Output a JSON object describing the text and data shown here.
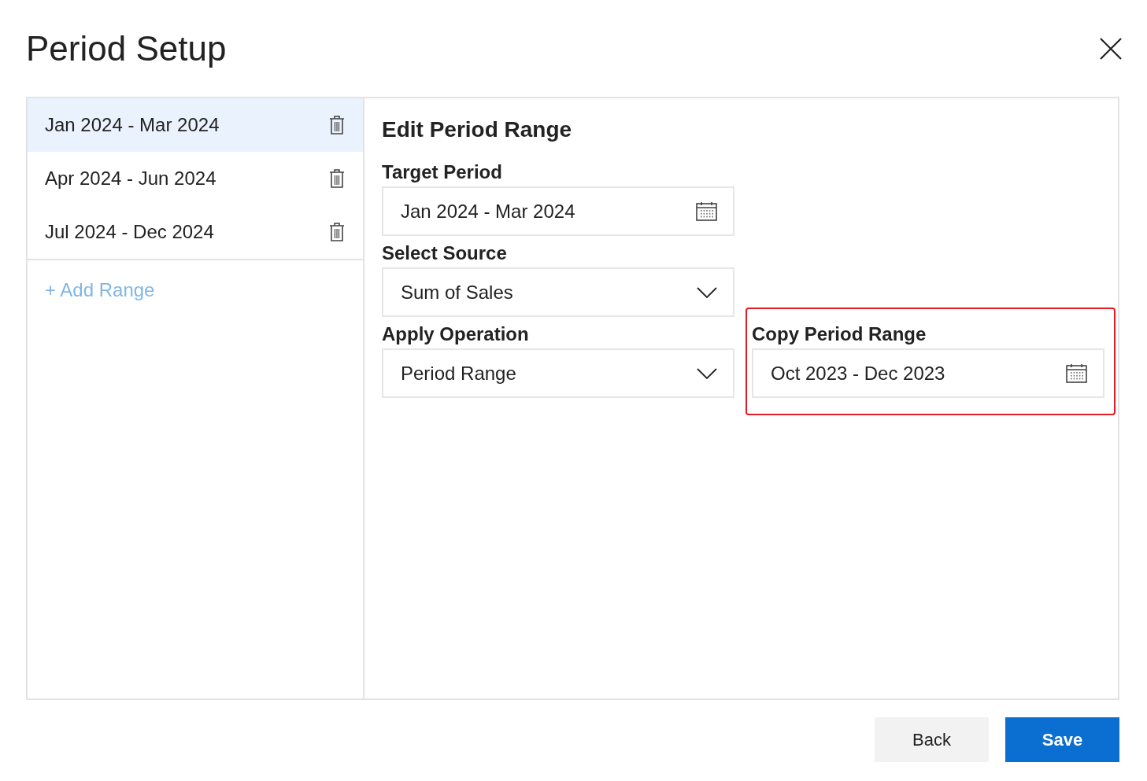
{
  "dialog": {
    "title": "Period Setup"
  },
  "ranges": [
    {
      "label": "Jan 2024 - Mar 2024",
      "selected": true
    },
    {
      "label": "Apr 2024 - Jun 2024",
      "selected": false
    },
    {
      "label": "Jul 2024 - Dec 2024",
      "selected": false
    }
  ],
  "add_range": "+ Add Range",
  "editor": {
    "heading": "Edit Period Range",
    "fields": [
      {
        "label": "Target Period",
        "kind": "date",
        "value": "Jan 2024 - Mar 2024"
      },
      {
        "label": "Select Source",
        "kind": "dropdown",
        "value": "Sum of Sales"
      },
      {
        "label": "Apply Operation",
        "kind": "dropdown",
        "value": "Period Range"
      }
    ],
    "copy": {
      "label": "Copy Period Range",
      "kind": "date",
      "value": "Oct 2023 - Dec 2023",
      "highlighted": true
    }
  },
  "buttons": [
    {
      "label": "Back",
      "kind": "secondary"
    },
    {
      "label": "Save",
      "kind": "primary"
    }
  ]
}
